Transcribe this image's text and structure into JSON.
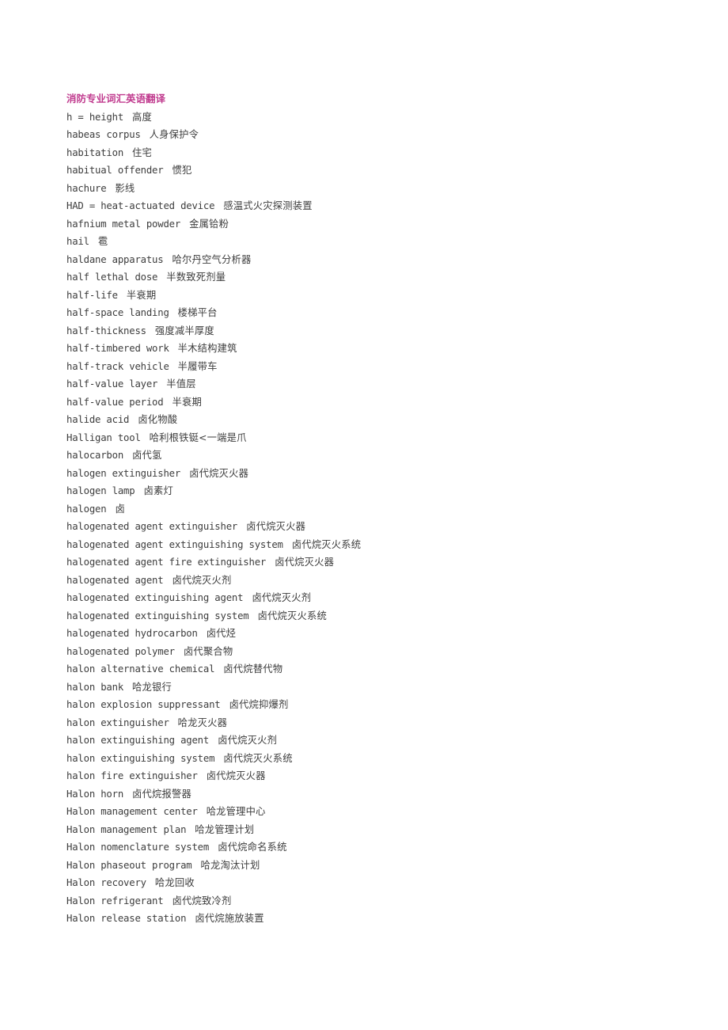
{
  "document": {
    "title": "消防专业词汇英语翻译",
    "title_color": "#c03a8e",
    "background_color": "#ffffff",
    "text_color": "#3d3d3d",
    "entry_count": 44
  },
  "entries": [
    {
      "term": "h = height",
      "translation": "高度"
    },
    {
      "term": "habeas corpus",
      "translation": "人身保护令"
    },
    {
      "term": "habitation",
      "translation": "住宅"
    },
    {
      "term": "habitual offender",
      "translation": "惯犯"
    },
    {
      "term": "hachure",
      "translation": "影线"
    },
    {
      "term": "HAD = heat-actuated device",
      "translation": "感温式火灾探测装置"
    },
    {
      "term": "hafnium metal powder",
      "translation": "金属铪粉"
    },
    {
      "term": "hail",
      "translation": "雹"
    },
    {
      "term": "haldane apparatus",
      "translation": "哈尔丹空气分析器"
    },
    {
      "term": "half lethal dose",
      "translation": "半数致死剂量"
    },
    {
      "term": "half-life",
      "translation": "半衰期"
    },
    {
      "term": "half-space landing",
      "translation": "楼梯平台"
    },
    {
      "term": "half-thickness",
      "translation": "强度减半厚度"
    },
    {
      "term": "half-timbered work",
      "translation": "半木结构建筑"
    },
    {
      "term": "half-track vehicle",
      "translation": "半履带车"
    },
    {
      "term": "half-value layer",
      "translation": "半值层"
    },
    {
      "term": "half-value period",
      "translation": "半衰期"
    },
    {
      "term": "halide acid",
      "translation": "卤化物酸"
    },
    {
      "term": "Halligan tool",
      "translation": "哈利根铁铤<一端是爪"
    },
    {
      "term": "halocarbon",
      "translation": "卤代氢"
    },
    {
      "term": "halogen extinguisher",
      "translation": "卤代烷灭火器"
    },
    {
      "term": "halogen lamp",
      "translation": "卤素灯"
    },
    {
      "term": "halogen",
      "translation": "卤"
    },
    {
      "term": "halogenated agent extinguisher",
      "translation": "卤代烷灭火器"
    },
    {
      "term": "halogenated agent extinguishing system",
      "translation": "卤代烷灭火系统"
    },
    {
      "term": "halogenated agent fire extinguisher",
      "translation": "卤代烷灭火器"
    },
    {
      "term": "halogenated agent",
      "translation": "卤代烷灭火剂"
    },
    {
      "term": "halogenated extinguishing agent",
      "translation": "卤代烷灭火剂"
    },
    {
      "term": "halogenated extinguishing system",
      "translation": "卤代烷灭火系统"
    },
    {
      "term": "halogenated hydrocarbon",
      "translation": "卤代烃"
    },
    {
      "term": "halogenated polymer",
      "translation": "卤代聚合物"
    },
    {
      "term": "halon alternative chemical",
      "translation": "卤代烷替代物"
    },
    {
      "term": "halon bank",
      "translation": "哈龙银行"
    },
    {
      "term": "halon explosion suppressant",
      "translation": "卤代烷抑爆剂"
    },
    {
      "term": "halon extinguisher",
      "translation": "哈龙灭火器"
    },
    {
      "term": "halon extinguishing agent",
      "translation": "卤代烷灭火剂"
    },
    {
      "term": "halon extinguishing system",
      "translation": "卤代烷灭火系统"
    },
    {
      "term": "halon fire extinguisher",
      "translation": "卤代烷灭火器"
    },
    {
      "term": "Halon horn",
      "translation": "卤代烷报警器"
    },
    {
      "term": "Halon management center",
      "translation": "哈龙管理中心"
    },
    {
      "term": "Halon management plan",
      "translation": "哈龙管理计划"
    },
    {
      "term": "Halon nomenclature system",
      "translation": "卤代烷命名系统"
    },
    {
      "term": "Halon phaseout program",
      "translation": "哈龙淘汰计划"
    },
    {
      "term": "Halon recovery",
      "translation": "哈龙回收"
    },
    {
      "term": "Halon refrigerant",
      "translation": "卤代烷致冷剂"
    },
    {
      "term": "Halon release station",
      "translation": "卤代烷施放装置"
    }
  ]
}
